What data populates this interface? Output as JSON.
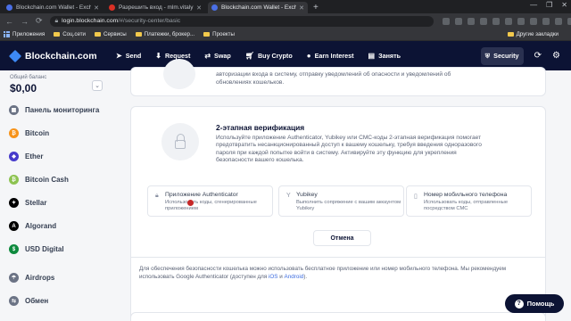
{
  "browser": {
    "tabs": [
      {
        "title": "Blockchain.com Wallet - Exchange",
        "active": false
      },
      {
        "title": "Разрешить вход - mlm.vitaly18@",
        "active": false
      },
      {
        "title": "Blockchain.com Wallet - Exchange",
        "active": true
      }
    ],
    "new_tab": "+",
    "window_controls": [
      "—",
      "❐",
      "✕"
    ],
    "url_host": "login.blockchain.com",
    "url_path": "/#/security-center/basic",
    "bookmarks": [
      {
        "label": "Приложения",
        "icon": "apps-icon"
      },
      {
        "label": "Соц.сети",
        "icon": "folder-icon"
      },
      {
        "label": "Сервисы",
        "icon": "folder-icon"
      },
      {
        "label": "Платежки, брокер...",
        "icon": "folder-icon"
      },
      {
        "label": "Проекты",
        "icon": "folder-icon"
      }
    ],
    "other_bookmarks": "Другие закладки"
  },
  "header": {
    "logo_text": "Blockchain.com",
    "nav": [
      {
        "label": "Send",
        "icon": "send-icon"
      },
      {
        "label": "Request",
        "icon": "request-icon"
      },
      {
        "label": "Swap",
        "icon": "swap-icon"
      },
      {
        "label": "Buy Crypto",
        "icon": "cart-icon"
      },
      {
        "label": "Earn Interest",
        "icon": "interest-icon"
      },
      {
        "label": "Занять",
        "icon": "borrow-icon"
      }
    ],
    "security_label": "Security"
  },
  "sidebar": {
    "balance_label": "Общий баланс",
    "balance_value": "$0,00",
    "items": [
      {
        "label": "Панель мониторинга",
        "icon": "dashboard-icon",
        "color": "#6b7385"
      },
      {
        "label": "Bitcoin",
        "icon": "bitcoin-icon",
        "color": "#f7931a"
      },
      {
        "label": "Ether",
        "icon": "ether-icon",
        "color": "#473bcb"
      },
      {
        "label": "Bitcoin Cash",
        "icon": "bitcoin-cash-icon",
        "color": "#8dc351"
      },
      {
        "label": "Stellar",
        "icon": "stellar-icon",
        "color": "#000000"
      },
      {
        "label": "Algorand",
        "icon": "algorand-icon",
        "color": "#000000"
      },
      {
        "label": "USD Digital",
        "icon": "usd-digital-icon",
        "color": "#0e8a3e"
      },
      {
        "label": "Airdrops",
        "icon": "airdrops-icon",
        "color": "#6b7385"
      },
      {
        "label": "Обмен",
        "icon": "exchange-icon",
        "color": "#6b7385"
      }
    ]
  },
  "main": {
    "top_card_text": "авторизации входа в систему, отправку уведомлений об опасности и уведомлений об обновлениях кошельков.",
    "twofa": {
      "title": "2-этапная верификация",
      "description": "Используйте приложение Authenticator, Yubikey или СМС-коды 2-этапная верификация помогает предотвратить несанкционированный доступ к вашему кошельку, требуя введения одноразового пароля при каждой попытке войти в систему. Активируйте эту функцию для укрепления безопасности вашего кошелька.",
      "options": [
        {
          "title": "Приложение Authenticator",
          "desc": "Использовать коды, сгенерированные приложением",
          "icon": "lock-icon"
        },
        {
          "title": "Yubikey",
          "desc": "Выполнить сопряжение с вашим аккаунтом Yubikey",
          "icon": "yubikey-icon"
        },
        {
          "title": "Номер мобильного телефона",
          "desc": "Использовать коды, отправленные посредством СМС",
          "icon": "phone-icon"
        }
      ],
      "cancel_label": "Отмена",
      "footnote_text": "Для обеспечения безопасности кошелька можно использовать бесплатное приложение или номер мобильного телефона. Мы рекомендуем использовать Google Authenticator (доступен для",
      "footnote_ios": "iOS",
      "footnote_and": "и",
      "footnote_android": "Android",
      "footnote_end": ")."
    }
  },
  "help_label": "Помощь",
  "colors": {
    "header_bg": "#0c1334",
    "accent": "#3d89f5",
    "link": "#3d6de0"
  }
}
